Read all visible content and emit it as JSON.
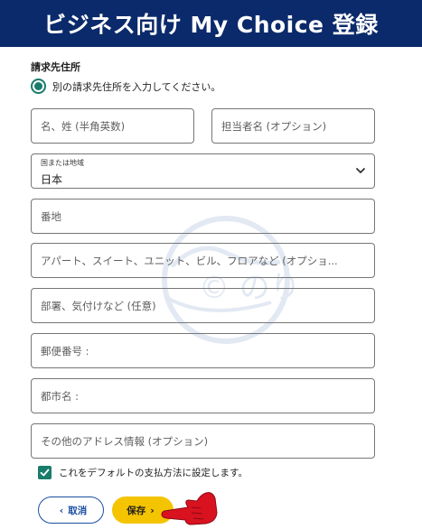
{
  "banner": {
    "title": "ビジネス向け My Choice 登録"
  },
  "billing": {
    "section_title": "請求先住所",
    "radio_label": "別の請求先住所を入力してください。"
  },
  "form": {
    "name_placeholder": "名、姓 (半角英数)",
    "contact_placeholder": "担当者名 (オプション)",
    "country_label": "国または地域",
    "country_value": "日本",
    "street_placeholder": "番地",
    "apartment_placeholder": "アパート、スイート、ユニット、ビル、フロアなど (オプショ...",
    "department_placeholder": "部署、気付けなど (任意)",
    "postal_placeholder": "郵便番号 :",
    "city_placeholder": "都市名 :",
    "other_placeholder": "その他のアドレス情報 (オプション)"
  },
  "default_checkbox": {
    "label": "これをデフォルトの支払方法に設定します。",
    "checked": true
  },
  "actions": {
    "cancel_label": "取消",
    "save_label": "保存"
  },
  "watermark": {
    "text": "© のり"
  },
  "colors": {
    "banner": "#0b2a6b",
    "accent": "#1a7c6b",
    "save": "#f5c400",
    "cancel_border": "#1b4fa3",
    "pointer": "#d9121f"
  },
  "icons": {
    "cancel": "chevron-left-icon",
    "save": "chevron-right-icon",
    "select": "chevron-down-icon",
    "pointer": "pointing-hand-icon"
  }
}
